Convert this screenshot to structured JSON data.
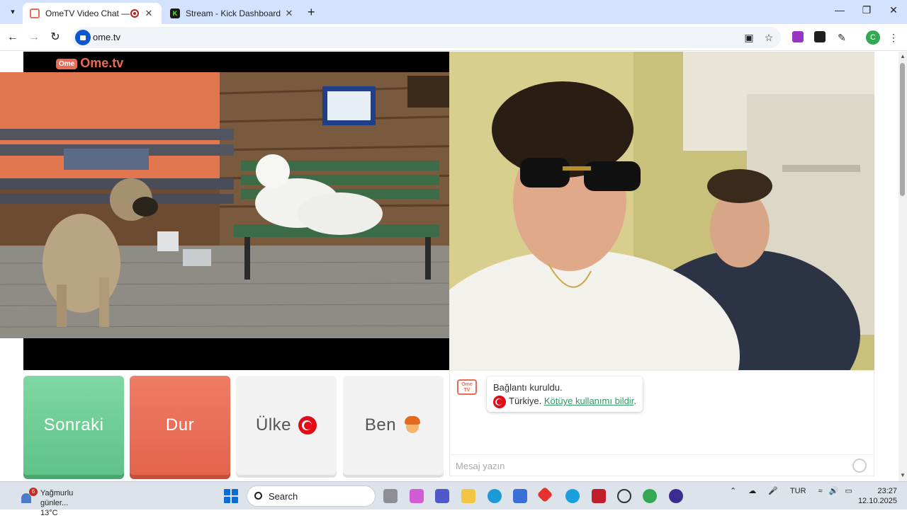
{
  "browser": {
    "tabs": [
      {
        "title": "OmeTV Video Chat — Ome",
        "active": true
      },
      {
        "title": "Stream - Kick Dashboard",
        "active": false
      }
    ],
    "url": "ome.tv",
    "profile_initial": "C"
  },
  "page": {
    "logo_badge": "Ome",
    "logo_text": "Ome.tv",
    "buttons": {
      "next": "Sonraki",
      "stop": "Dur",
      "country": "Ülke",
      "me": "Ben"
    },
    "chat": {
      "logo_line1": "Ome",
      "logo_line2": "TV",
      "status": "Bağlantı kuruldu.",
      "country": "Türkiye.",
      "report_link": "Kötüye kullanımı bildir",
      "report_suffix": ".",
      "input_placeholder": "Mesaj yazın"
    }
  },
  "taskbar": {
    "weather_badge": "6",
    "weather_text": "Yağmurlu günler...",
    "temperature": "13°C",
    "search_label": "Search",
    "language": "TUR",
    "time": "23:27",
    "date": "12.10.2025"
  },
  "colors": {
    "next_button": "#6ccf94",
    "stop_button": "#e86b56",
    "link": "#2f9a63",
    "tabstrip": "#d3e3fd"
  }
}
